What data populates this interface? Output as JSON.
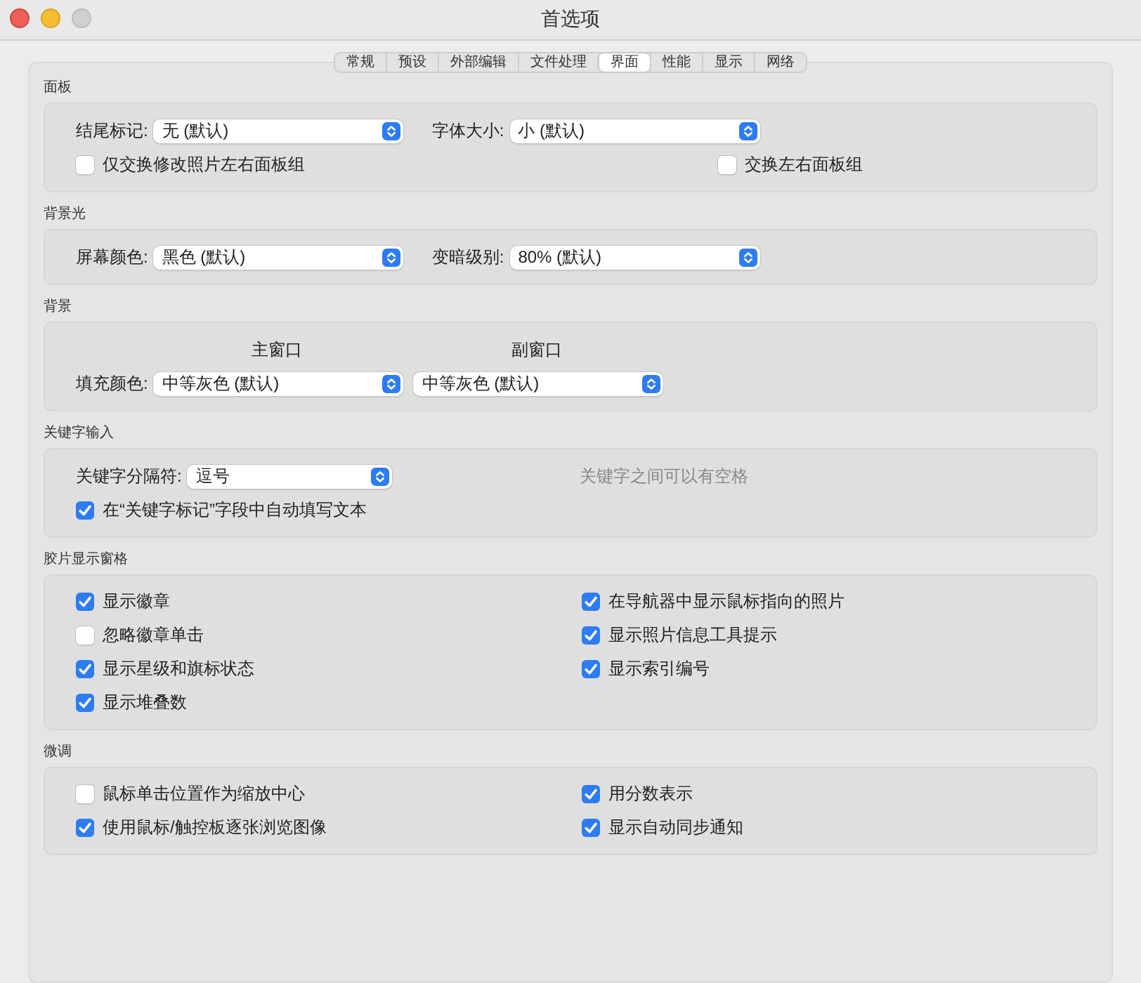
{
  "window": {
    "title": "首选项"
  },
  "tabs": [
    {
      "label": "常规",
      "selected": false
    },
    {
      "label": "预设",
      "selected": false
    },
    {
      "label": "外部编辑",
      "selected": false
    },
    {
      "label": "文件处理",
      "selected": false
    },
    {
      "label": "界面",
      "selected": true
    },
    {
      "label": "性能",
      "selected": false
    },
    {
      "label": "显示",
      "selected": false
    },
    {
      "label": "网络",
      "selected": false
    }
  ],
  "sections": [
    {
      "title": "面板",
      "rows": [
        {
          "kind": "fields",
          "items": [
            {
              "kind": "select",
              "label": "结尾标记:",
              "value": "无 (默认)"
            },
            {
              "kind": "select",
              "label": "字体大小:",
              "value": "小 (默认)"
            }
          ]
        },
        {
          "kind": "pair",
          "items": [
            {
              "kind": "checkbox",
              "label": "仅交换修改照片左右面板组",
              "checked": false
            },
            {
              "kind": "checkbox",
              "label": "交换左右面板组",
              "checked": false
            }
          ]
        }
      ]
    },
    {
      "title": "背景光",
      "rows": [
        {
          "kind": "fields",
          "items": [
            {
              "kind": "select",
              "label": "屏幕颜色:",
              "value": "黑色 (默认)"
            },
            {
              "kind": "select",
              "label": "变暗级别:",
              "value": "80% (默认)"
            }
          ]
        }
      ]
    },
    {
      "title": "背景",
      "rows": [
        {
          "kind": "headings",
          "items": [
            {
              "kind": "heading",
              "label": "主窗口"
            },
            {
              "kind": "heading",
              "label": "副窗口"
            }
          ]
        },
        {
          "kind": "fields",
          "items": [
            {
              "kind": "select",
              "label": "填充颜色:",
              "value": "中等灰色 (默认)"
            },
            {
              "kind": "select",
              "value": "中等灰色 (默认)"
            }
          ]
        }
      ]
    },
    {
      "title": "关键字输入",
      "rows": [
        {
          "kind": "fields",
          "items": [
            {
              "kind": "combo",
              "label": "关键字分隔符:",
              "value": "逗号"
            },
            {
              "kind": "note",
              "label": "关键字之间可以有空格"
            }
          ]
        },
        {
          "kind": "single",
          "items": [
            {
              "kind": "checkbox",
              "label": "在“关键字标记”字段中自动填写文本",
              "checked": true
            }
          ]
        }
      ]
    },
    {
      "title": "胶片显示窗格",
      "rows": [
        {
          "kind": "grid",
          "items": [
            {
              "kind": "checkbox",
              "label": "显示徽章",
              "checked": true
            },
            {
              "kind": "checkbox",
              "label": "在导航器中显示鼠标指向的照片",
              "checked": true
            },
            {
              "kind": "checkbox",
              "label": "忽略徽章单击",
              "checked": false
            },
            {
              "kind": "checkbox",
              "label": "显示照片信息工具提示",
              "checked": true
            },
            {
              "kind": "checkbox",
              "label": "显示星级和旗标状态",
              "checked": true
            },
            {
              "kind": "checkbox",
              "label": "显示索引编号",
              "checked": true
            },
            {
              "kind": "checkbox",
              "label": "显示堆叠数",
              "checked": true
            }
          ]
        }
      ]
    },
    {
      "title": "微调",
      "rows": [
        {
          "kind": "grid",
          "items": [
            {
              "kind": "checkbox",
              "label": "鼠标单击位置作为缩放中心",
              "checked": false
            },
            {
              "kind": "checkbox",
              "label": "用分数表示",
              "checked": true
            },
            {
              "kind": "checkbox",
              "label": "使用鼠标/触控板逐张浏览图像",
              "checked": true
            },
            {
              "kind": "checkbox",
              "label": "显示自动同步通知",
              "checked": true
            }
          ]
        }
      ]
    }
  ]
}
